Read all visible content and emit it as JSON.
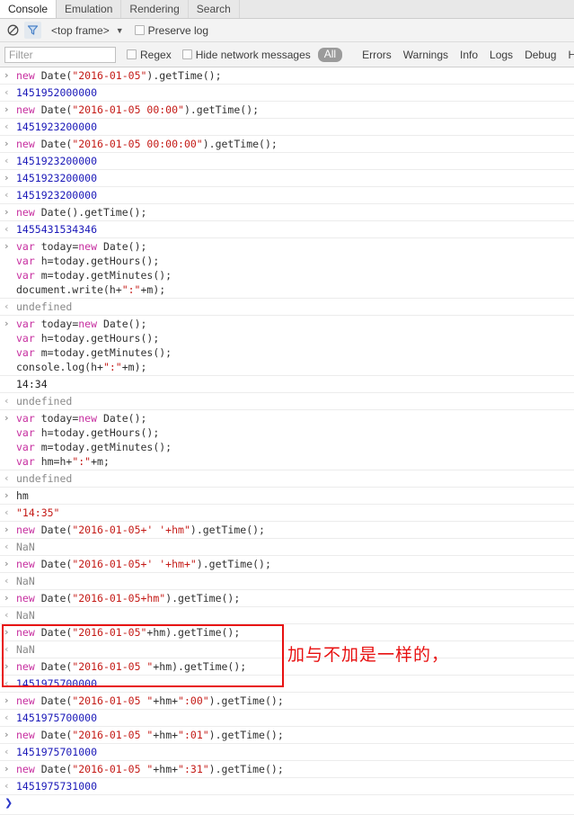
{
  "tabs": [
    {
      "label": "Console",
      "active": true
    },
    {
      "label": "Emulation",
      "active": false
    },
    {
      "label": "Rendering",
      "active": false
    },
    {
      "label": "Search",
      "active": false
    }
  ],
  "toolbar": {
    "clear_icon": "clear-console-icon",
    "filter_icon": "filter-funnel-icon",
    "frame_label": "<top frame>",
    "frame_caret": "▼",
    "preserve_log_label": "Preserve log",
    "preserve_log_checked": false
  },
  "filterbar": {
    "input_value": "",
    "input_placeholder": "Filter",
    "regex_label": "Regex",
    "regex_checked": false,
    "hide_network_label": "Hide network messages",
    "hide_network_checked": false,
    "all_label": "All",
    "levels": [
      "Errors",
      "Warnings",
      "Info",
      "Logs",
      "Debug",
      "Handled"
    ]
  },
  "gutter": {
    "input_arrow": "›",
    "output_arrow": "‹",
    "prompt_arrow": "❯"
  },
  "annotation": {
    "text": "加与不加是一样的，",
    "color": "#e81010"
  },
  "colors": {
    "number": "#1a18b8",
    "string": "#c41a16",
    "keyword": "#c72fa0",
    "plain": "#303030",
    "muted": "#8a8a8a",
    "accent_blue": "#2a36c8"
  },
  "console_rows": [
    {
      "kind": "input",
      "tokens": [
        {
          "t": "kw",
          "v": "new "
        },
        {
          "t": "plain",
          "v": "Date("
        },
        {
          "t": "str",
          "v": "\"2016-01-05\""
        },
        {
          "t": "plain",
          "v": ").getTime();"
        }
      ]
    },
    {
      "kind": "output",
      "tokens": [
        {
          "t": "num",
          "v": "1451952000000"
        }
      ]
    },
    {
      "kind": "input",
      "tokens": [
        {
          "t": "kw",
          "v": "new "
        },
        {
          "t": "plain",
          "v": "Date("
        },
        {
          "t": "str",
          "v": "\"2016-01-05 00:00\""
        },
        {
          "t": "plain",
          "v": ").getTime();"
        }
      ]
    },
    {
      "kind": "output",
      "tokens": [
        {
          "t": "num",
          "v": "1451923200000"
        }
      ]
    },
    {
      "kind": "input",
      "tokens": [
        {
          "t": "kw",
          "v": "new "
        },
        {
          "t": "plain",
          "v": "Date("
        },
        {
          "t": "str",
          "v": "\"2016-01-05 00:00:00\""
        },
        {
          "t": "plain",
          "v": ").getTime();"
        }
      ]
    },
    {
      "kind": "output",
      "tokens": [
        {
          "t": "num",
          "v": "1451923200000"
        }
      ]
    },
    {
      "kind": "input",
      "tokens": [
        {
          "t": "num",
          "v": "1451923200000"
        }
      ]
    },
    {
      "kind": "output",
      "tokens": [
        {
          "t": "num",
          "v": "1451923200000"
        }
      ]
    },
    {
      "kind": "input",
      "tokens": [
        {
          "t": "kw",
          "v": "new "
        },
        {
          "t": "plain",
          "v": "Date().getTime();"
        }
      ]
    },
    {
      "kind": "output",
      "tokens": [
        {
          "t": "num",
          "v": "1455431534346"
        }
      ]
    },
    {
      "kind": "input",
      "tokens": [
        {
          "t": "kw",
          "v": "var "
        },
        {
          "t": "plain",
          "v": "today="
        },
        {
          "t": "kw",
          "v": "new "
        },
        {
          "t": "plain",
          "v": "Date();\n"
        },
        {
          "t": "kw",
          "v": "var "
        },
        {
          "t": "plain",
          "v": "h=today.getHours();\n"
        },
        {
          "t": "kw",
          "v": "var "
        },
        {
          "t": "plain",
          "v": "m=today.getMinutes();\n"
        },
        {
          "t": "plain",
          "v": "document.write(h+"
        },
        {
          "t": "str",
          "v": "\":\""
        },
        {
          "t": "plain",
          "v": "+m);"
        }
      ]
    },
    {
      "kind": "output",
      "tokens": [
        {
          "t": "nanv",
          "v": "undefined"
        }
      ]
    },
    {
      "kind": "input",
      "tokens": [
        {
          "t": "kw",
          "v": "var "
        },
        {
          "t": "plain",
          "v": "today="
        },
        {
          "t": "kw",
          "v": "new "
        },
        {
          "t": "plain",
          "v": "Date();\n"
        },
        {
          "t": "kw",
          "v": "var "
        },
        {
          "t": "plain",
          "v": "h=today.getHours();\n"
        },
        {
          "t": "kw",
          "v": "var "
        },
        {
          "t": "plain",
          "v": "m=today.getMinutes();\n"
        },
        {
          "t": "plain",
          "v": "console.log(h+"
        },
        {
          "t": "str",
          "v": "\":\""
        },
        {
          "t": "plain",
          "v": "+m);"
        }
      ]
    },
    {
      "kind": "log",
      "tokens": [
        {
          "t": "logline",
          "v": "14:34"
        }
      ]
    },
    {
      "kind": "output",
      "tokens": [
        {
          "t": "nanv",
          "v": "undefined"
        }
      ]
    },
    {
      "kind": "input",
      "tokens": [
        {
          "t": "kw",
          "v": "var "
        },
        {
          "t": "plain",
          "v": "today="
        },
        {
          "t": "kw",
          "v": "new "
        },
        {
          "t": "plain",
          "v": "Date();\n"
        },
        {
          "t": "kw",
          "v": "var "
        },
        {
          "t": "plain",
          "v": "h=today.getHours();\n"
        },
        {
          "t": "kw",
          "v": "var "
        },
        {
          "t": "plain",
          "v": "m=today.getMinutes();\n"
        },
        {
          "t": "kw",
          "v": "var "
        },
        {
          "t": "plain",
          "v": "hm=h+"
        },
        {
          "t": "str",
          "v": "\":\""
        },
        {
          "t": "plain",
          "v": "+m;"
        }
      ]
    },
    {
      "kind": "output",
      "tokens": [
        {
          "t": "nanv",
          "v": "undefined"
        }
      ]
    },
    {
      "kind": "input",
      "tokens": [
        {
          "t": "plain",
          "v": "hm"
        }
      ]
    },
    {
      "kind": "output",
      "tokens": [
        {
          "t": "str",
          "v": "\"14:35\""
        }
      ]
    },
    {
      "kind": "input",
      "tokens": [
        {
          "t": "kw",
          "v": "new "
        },
        {
          "t": "plain",
          "v": "Date("
        },
        {
          "t": "str",
          "v": "\"2016-01-05+' '+hm\""
        },
        {
          "t": "plain",
          "v": ").getTime();"
        }
      ]
    },
    {
      "kind": "output",
      "tokens": [
        {
          "t": "nanv",
          "v": "NaN"
        }
      ]
    },
    {
      "kind": "input",
      "tokens": [
        {
          "t": "kw",
          "v": "new "
        },
        {
          "t": "plain",
          "v": "Date("
        },
        {
          "t": "str",
          "v": "\"2016-01-05+' '+hm+\""
        },
        {
          "t": "plain",
          "v": ").getTime();"
        }
      ]
    },
    {
      "kind": "output",
      "tokens": [
        {
          "t": "nanv",
          "v": "NaN"
        }
      ]
    },
    {
      "kind": "input",
      "tokens": [
        {
          "t": "kw",
          "v": "new "
        },
        {
          "t": "plain",
          "v": "Date("
        },
        {
          "t": "str",
          "v": "\"2016-01-05+hm\""
        },
        {
          "t": "plain",
          "v": ").getTime();"
        }
      ]
    },
    {
      "kind": "output",
      "tokens": [
        {
          "t": "nanv",
          "v": "NaN"
        }
      ]
    },
    {
      "kind": "input",
      "tokens": [
        {
          "t": "kw",
          "v": "new "
        },
        {
          "t": "plain",
          "v": "Date("
        },
        {
          "t": "str",
          "v": "\"2016-01-05\""
        },
        {
          "t": "plain",
          "v": "+hm).getTime();"
        }
      ]
    },
    {
      "kind": "output",
      "tokens": [
        {
          "t": "nanv",
          "v": "NaN"
        }
      ]
    },
    {
      "kind": "input",
      "tokens": [
        {
          "t": "kw",
          "v": "new "
        },
        {
          "t": "plain",
          "v": "Date("
        },
        {
          "t": "str",
          "v": "\"2016-01-05 \""
        },
        {
          "t": "plain",
          "v": "+hm).getTime();"
        }
      ]
    },
    {
      "kind": "output",
      "tokens": [
        {
          "t": "num",
          "v": "1451975700000"
        }
      ]
    },
    {
      "kind": "input",
      "tokens": [
        {
          "t": "kw",
          "v": "new "
        },
        {
          "t": "plain",
          "v": "Date("
        },
        {
          "t": "str",
          "v": "\"2016-01-05 \""
        },
        {
          "t": "plain",
          "v": "+hm+"
        },
        {
          "t": "str",
          "v": "\":00\""
        },
        {
          "t": "plain",
          "v": ").getTime();"
        }
      ]
    },
    {
      "kind": "output",
      "tokens": [
        {
          "t": "num",
          "v": "1451975700000"
        }
      ]
    },
    {
      "kind": "input",
      "tokens": [
        {
          "t": "kw",
          "v": "new "
        },
        {
          "t": "plain",
          "v": "Date("
        },
        {
          "t": "str",
          "v": "\"2016-01-05 \""
        },
        {
          "t": "plain",
          "v": "+hm+"
        },
        {
          "t": "str",
          "v": "\":01\""
        },
        {
          "t": "plain",
          "v": ").getTime();"
        }
      ]
    },
    {
      "kind": "output",
      "tokens": [
        {
          "t": "num",
          "v": "1451975701000"
        }
      ]
    },
    {
      "kind": "input",
      "tokens": [
        {
          "t": "kw",
          "v": "new "
        },
        {
          "t": "plain",
          "v": "Date("
        },
        {
          "t": "str",
          "v": "\"2016-01-05 \""
        },
        {
          "t": "plain",
          "v": "+hm+"
        },
        {
          "t": "str",
          "v": "\":31\""
        },
        {
          "t": "plain",
          "v": ").getTime();"
        }
      ]
    },
    {
      "kind": "output",
      "tokens": [
        {
          "t": "num",
          "v": "1451975731000"
        }
      ]
    },
    {
      "kind": "prompt",
      "tokens": []
    }
  ]
}
